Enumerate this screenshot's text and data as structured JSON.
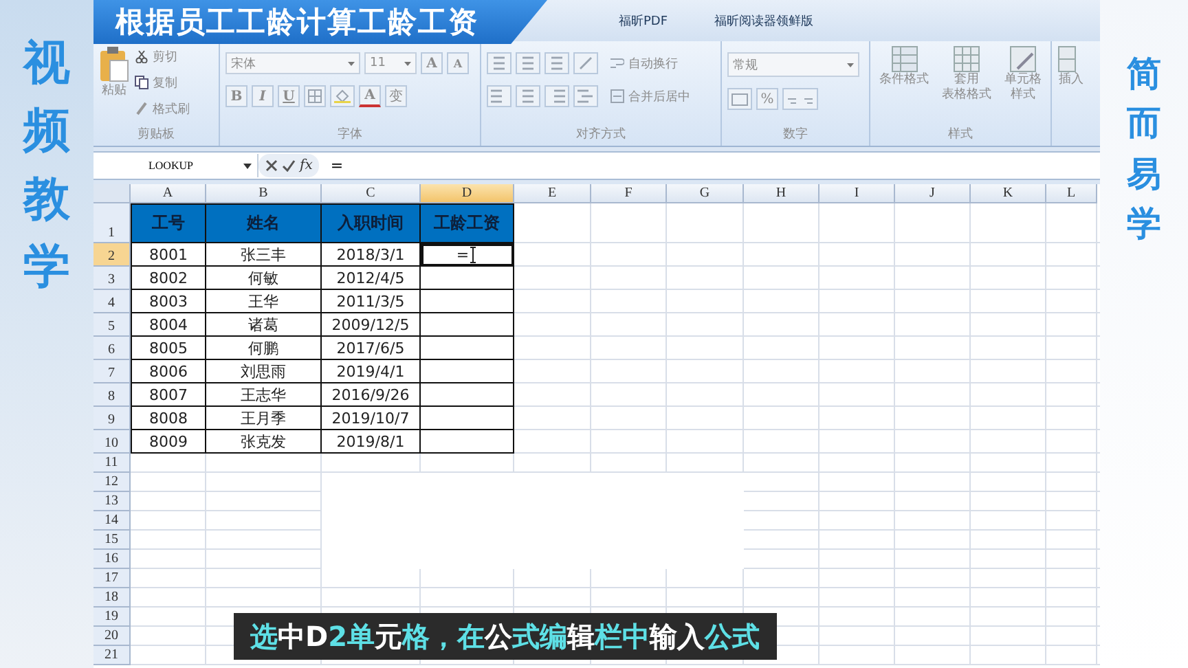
{
  "side_left": {
    "text": "视频教学"
  },
  "side_right": {
    "text": "简而易学"
  },
  "title_banner": {
    "text": "根据员工工龄计算工龄工资"
  },
  "ribbon_tabs": [
    {
      "label": "福昕PDF",
      "selected": false
    },
    {
      "label": "福昕阅读器领鲜版",
      "selected": false
    }
  ],
  "ribbon": {
    "disabled": true,
    "clipboard": {
      "label": "剪贴板",
      "paste": "粘贴",
      "cut": "剪切",
      "copy": "复制",
      "format_painter": "格式刷"
    },
    "font": {
      "label": "字体",
      "font_name": "宋体",
      "font_size": "11",
      "grow": "A",
      "shrink": "A",
      "bold": "B",
      "italic": "I",
      "underline": "U",
      "font_color": "A",
      "phonetic": "变"
    },
    "alignment": {
      "label": "对齐方式",
      "wrap_text": "自动换行",
      "merge_center": "合并后居中"
    },
    "number": {
      "label": "数字",
      "format": "常规",
      "percent": "%"
    },
    "styles": {
      "label": "样式",
      "conditional": "条件格式",
      "table_format": [
        "套用",
        "表格格式"
      ],
      "cell_styles": [
        "单元格",
        "样式"
      ]
    },
    "cells": {
      "insert": "插入"
    }
  },
  "formula_bar": {
    "name_box": "LOOKUP",
    "function_label": "fx",
    "formula": "="
  },
  "sheet": {
    "columns": [
      {
        "label": "A",
        "selected": false
      },
      {
        "label": "B",
        "selected": false
      },
      {
        "label": "C",
        "selected": false
      },
      {
        "label": "D",
        "selected": true
      },
      {
        "label": "E",
        "selected": false
      },
      {
        "label": "F",
        "selected": false
      },
      {
        "label": "G",
        "selected": false
      },
      {
        "label": "H",
        "selected": false
      },
      {
        "label": "I",
        "selected": false
      },
      {
        "label": "J",
        "selected": false
      },
      {
        "label": "K",
        "selected": false
      },
      {
        "label": "L",
        "selected": false
      }
    ],
    "rows": [
      {
        "label": "1",
        "selected": false,
        "kind": "header",
        "cells": [
          {
            "text": "工号"
          },
          {
            "text": "姓名"
          },
          {
            "text": "入职时间"
          },
          {
            "text": "工龄工资"
          }
        ]
      },
      {
        "label": "2",
        "selected": true,
        "kind": "data",
        "cells": [
          {
            "text": "8001",
            "active": false
          },
          {
            "text": "张三丰",
            "active": false
          },
          {
            "text": "2018/3/1",
            "active": false
          },
          {
            "text": "=",
            "active": true
          }
        ]
      },
      {
        "label": "3",
        "selected": false,
        "kind": "data",
        "cells": [
          {
            "text": "8002",
            "active": false
          },
          {
            "text": "何敏",
            "active": false
          },
          {
            "text": "2012/4/5",
            "active": false
          },
          {
            "active": false
          }
        ]
      },
      {
        "label": "4",
        "selected": false,
        "kind": "data",
        "cells": [
          {
            "text": "8003",
            "active": false
          },
          {
            "text": "王华",
            "active": false
          },
          {
            "text": "2011/3/5",
            "active": false
          },
          {
            "active": false
          }
        ]
      },
      {
        "label": "5",
        "selected": false,
        "kind": "data",
        "cells": [
          {
            "text": "8004",
            "active": false
          },
          {
            "text": "诸葛",
            "active": false
          },
          {
            "text": "2009/12/5",
            "active": false
          },
          {
            "active": false
          }
        ]
      },
      {
        "label": "6",
        "selected": false,
        "kind": "data",
        "cells": [
          {
            "text": "8005",
            "active": false
          },
          {
            "text": "何鹏",
            "active": false
          },
          {
            "text": "2017/6/5",
            "active": false
          },
          {
            "active": false
          }
        ]
      },
      {
        "label": "7",
        "selected": false,
        "kind": "data",
        "cells": [
          {
            "text": "8006",
            "active": false
          },
          {
            "text": "刘思雨",
            "active": false
          },
          {
            "text": "2019/4/1",
            "active": false
          },
          {
            "active": false
          }
        ]
      },
      {
        "label": "8",
        "selected": false,
        "kind": "data",
        "cells": [
          {
            "text": "8007",
            "active": false
          },
          {
            "text": "王志华",
            "active": false
          },
          {
            "text": "2016/9/26",
            "active": false
          },
          {
            "active": false
          }
        ]
      },
      {
        "label": "9",
        "selected": false,
        "kind": "data",
        "cells": [
          {
            "text": "8008",
            "active": false
          },
          {
            "text": "王月季",
            "active": false
          },
          {
            "text": "2019/10/7",
            "active": false
          },
          {
            "active": false
          }
        ]
      },
      {
        "label": "10",
        "selected": false,
        "kind": "data",
        "cells": [
          {
            "text": "8009",
            "active": false
          },
          {
            "text": "张克发",
            "active": false
          },
          {
            "text": "2019/8/1",
            "active": false
          },
          {
            "active": false
          }
        ]
      },
      {
        "label": "11",
        "selected": false,
        "kind": "empty"
      },
      {
        "label": "12",
        "selected": false,
        "kind": "empty"
      },
      {
        "label": "13",
        "selected": false,
        "kind": "empty"
      },
      {
        "label": "14",
        "selected": false,
        "kind": "empty"
      },
      {
        "label": "15",
        "selected": false,
        "kind": "empty"
      },
      {
        "label": "16",
        "selected": false,
        "kind": "empty"
      },
      {
        "label": "17",
        "selected": false,
        "kind": "empty"
      },
      {
        "label": "18",
        "selected": false,
        "kind": "empty"
      },
      {
        "label": "19",
        "selected": false,
        "kind": "empty"
      },
      {
        "label": "20",
        "selected": false,
        "kind": "empty"
      },
      {
        "label": "21",
        "selected": false,
        "kind": "empty"
      }
    ]
  },
  "caption": {
    "segments": [
      {
        "text": "选",
        "highlighted": true
      },
      {
        "text": "中D",
        "highlighted": false
      },
      {
        "text": "2单",
        "highlighted": true
      },
      {
        "text": "元",
        "highlighted": false
      },
      {
        "text": "格，在",
        "highlighted": true
      },
      {
        "text": "公",
        "highlighted": false
      },
      {
        "text": "式编",
        "highlighted": true
      },
      {
        "text": "辑",
        "highlighted": false
      },
      {
        "text": "栏中",
        "highlighted": true
      },
      {
        "text": "输入",
        "highlighted": false
      },
      {
        "text": "公式",
        "highlighted": true
      }
    ]
  }
}
